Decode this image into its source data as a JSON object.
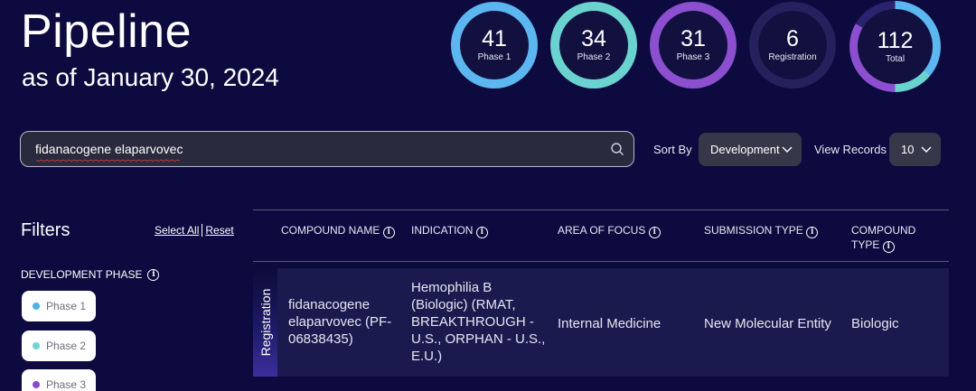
{
  "header": {
    "title": "Pipeline",
    "subtitle": "as of January 30, 2024"
  },
  "stats": [
    {
      "value": "41",
      "label": "Phase 1",
      "color": "#5cb6f0"
    },
    {
      "value": "34",
      "label": "Phase 2",
      "color": "#6ad3cf"
    },
    {
      "value": "31",
      "label": "Phase 3",
      "color": "#8b4fd0"
    },
    {
      "value": "6",
      "label": "Registration",
      "color": "#26215c"
    },
    {
      "value": "112",
      "label": "Total",
      "color": "#4a62d8"
    }
  ],
  "search": {
    "value": "fidanacogene elaparvovec",
    "icon": "search-icon"
  },
  "sort": {
    "label": "Sort By",
    "selected": "Development"
  },
  "records": {
    "label": "View Records",
    "selected": "10"
  },
  "filters": {
    "title": "Filters",
    "select_all": "Select All",
    "reset": "Reset",
    "section_label": "DEVELOPMENT PHASE",
    "phases": [
      {
        "label": "Phase 1",
        "color": "#4bb3e8"
      },
      {
        "label": "Phase 2",
        "color": "#6fd6cf"
      },
      {
        "label": "Phase 3",
        "color": "#8a4ccf"
      }
    ]
  },
  "table": {
    "columns": {
      "compound_name": "COMPOUND NAME",
      "indication": "INDICATION",
      "area_of_focus": "AREA OF FOCUS",
      "submission_type": "SUBMISSION TYPE",
      "compound_type": "COMPOUND TYPE"
    },
    "rows": [
      {
        "phase": "Registration",
        "compound_name": "fidanacogene elaparvovec (PF-06838435)",
        "indication": "Hemophilia B (Biologic) (RMAT, BREAKTHROUGH - U.S., ORPHAN - U.S., E.U.)",
        "area_of_focus": "Internal Medicine",
        "submission_type": "New Molecular Entity",
        "compound_type": "Biologic"
      }
    ]
  }
}
